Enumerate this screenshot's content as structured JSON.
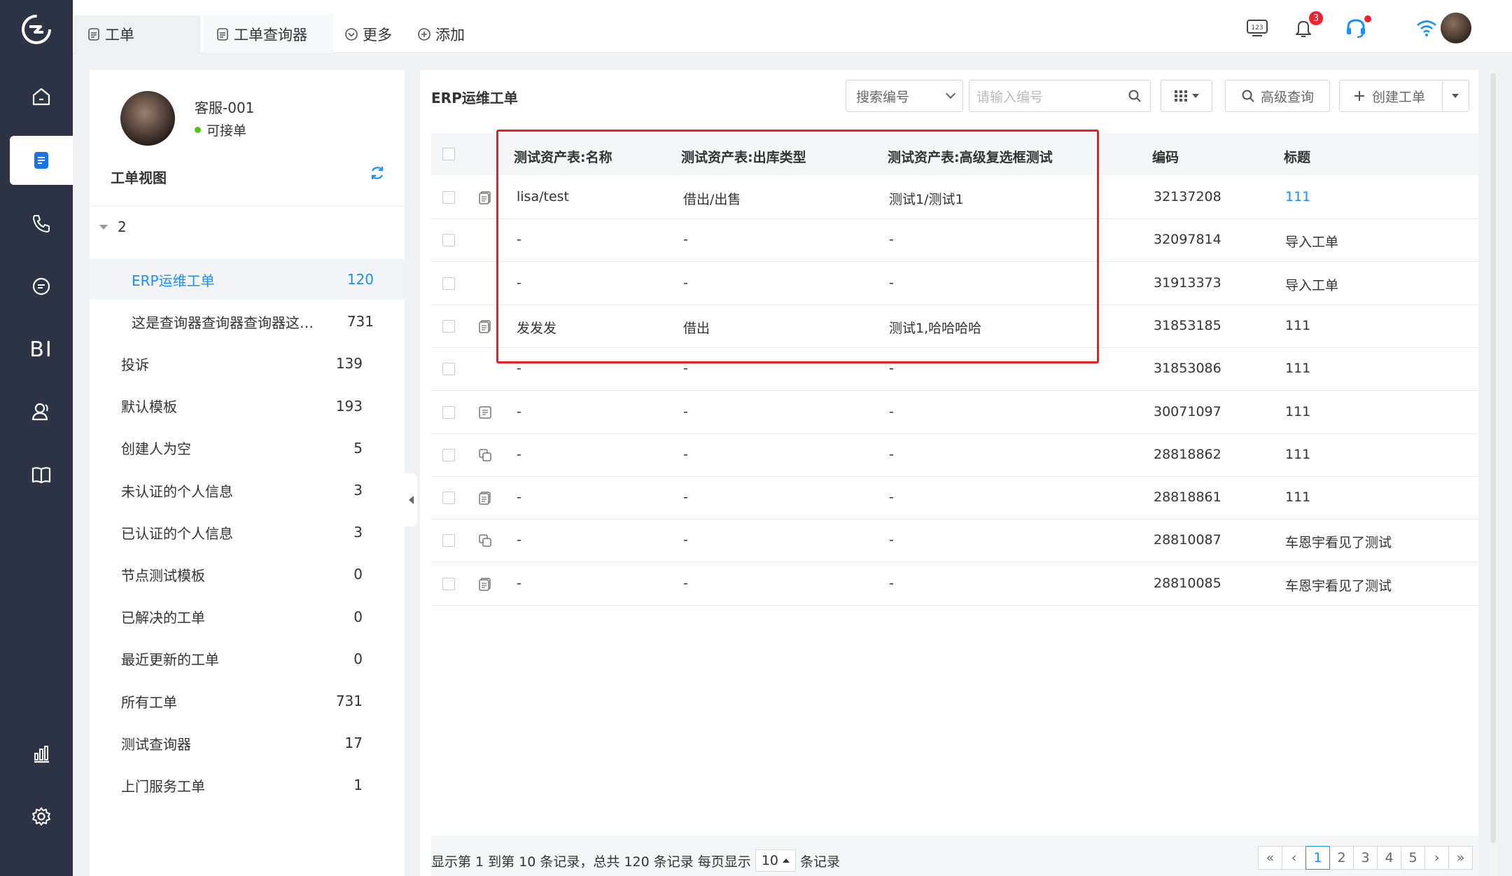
{
  "nav": {
    "bi_label": "BI"
  },
  "tabs": [
    {
      "label": "工单"
    },
    {
      "label": "工单查询器"
    },
    {
      "label": "更多"
    },
    {
      "label": "添加"
    }
  ],
  "topbar": {
    "notification_count": "3",
    "keyboard_label": "123"
  },
  "user": {
    "name": "客服-001",
    "status": "可接单"
  },
  "views": {
    "title": "工单视图",
    "group": "2",
    "items": [
      {
        "label": "ERP运维工单",
        "count": "120",
        "active": true,
        "indent": true
      },
      {
        "label": "这是查询器查询器查询器这…",
        "count": "731",
        "indent": true
      },
      {
        "label": "投诉",
        "count": "139"
      },
      {
        "label": "默认模板",
        "count": "193"
      },
      {
        "label": "创建人为空",
        "count": "5"
      },
      {
        "label": "未认证的个人信息",
        "count": "3"
      },
      {
        "label": "已认证的个人信息",
        "count": "3"
      },
      {
        "label": "节点测试模板",
        "count": "0"
      },
      {
        "label": "已解决的工单",
        "count": "0"
      },
      {
        "label": "最近更新的工单",
        "count": "0"
      },
      {
        "label": "所有工单",
        "count": "731"
      },
      {
        "label": "测试查询器",
        "count": "17"
      },
      {
        "label": "上门服务工单",
        "count": "1"
      }
    ]
  },
  "main": {
    "title": "ERP运维工单",
    "search_select": "搜索编号",
    "search_placeholder": "请输入编号",
    "advanced_query": "高级查询",
    "create_ticket": "创建工单"
  },
  "table": {
    "headers": [
      "测试资产表:名称",
      "测试资产表:出库类型",
      "测试资产表:高级复选框测试",
      "编码",
      "标题"
    ],
    "rows": [
      {
        "icon": "doc",
        "name": "lisa/test",
        "type": "借出/出售",
        "multi": "测试1/测试1",
        "code": "32137208",
        "title": "111",
        "title_link": true
      },
      {
        "icon": "",
        "name": "-",
        "type": "-",
        "multi": "-",
        "code": "32097814",
        "title": "导入工单"
      },
      {
        "icon": "",
        "name": "-",
        "type": "-",
        "multi": "-",
        "code": "31913373",
        "title": "导入工单"
      },
      {
        "icon": "doc",
        "name": "发发发",
        "type": "借出",
        "multi": "测试1,哈哈哈哈",
        "code": "31853185",
        "title": "111"
      },
      {
        "icon": "",
        "name": "-",
        "type": "-",
        "multi": "-",
        "code": "31853086",
        "title": "111"
      },
      {
        "icon": "list",
        "name": "-",
        "type": "-",
        "multi": "-",
        "code": "30071097",
        "title": "111"
      },
      {
        "icon": "copy",
        "name": "-",
        "type": "-",
        "multi": "-",
        "code": "28818862",
        "title": "111"
      },
      {
        "icon": "doc",
        "name": "-",
        "type": "-",
        "multi": "-",
        "code": "28818861",
        "title": "111"
      },
      {
        "icon": "copy",
        "name": "-",
        "type": "-",
        "multi": "-",
        "code": "28810087",
        "title": "车恩宇看见了测试"
      },
      {
        "icon": "doc",
        "name": "-",
        "type": "-",
        "multi": "-",
        "code": "28810085",
        "title": "车恩宇看见了测试"
      }
    ]
  },
  "pagination": {
    "summary": "显示第 1 到第 10 条记录，总共 120 条记录 每页显示",
    "page_size": "10",
    "suffix": "条记录",
    "first": "«",
    "prev": "‹",
    "pages": [
      "1",
      "2",
      "3",
      "4",
      "5"
    ],
    "current": "1",
    "next": "›",
    "last": "»"
  }
}
